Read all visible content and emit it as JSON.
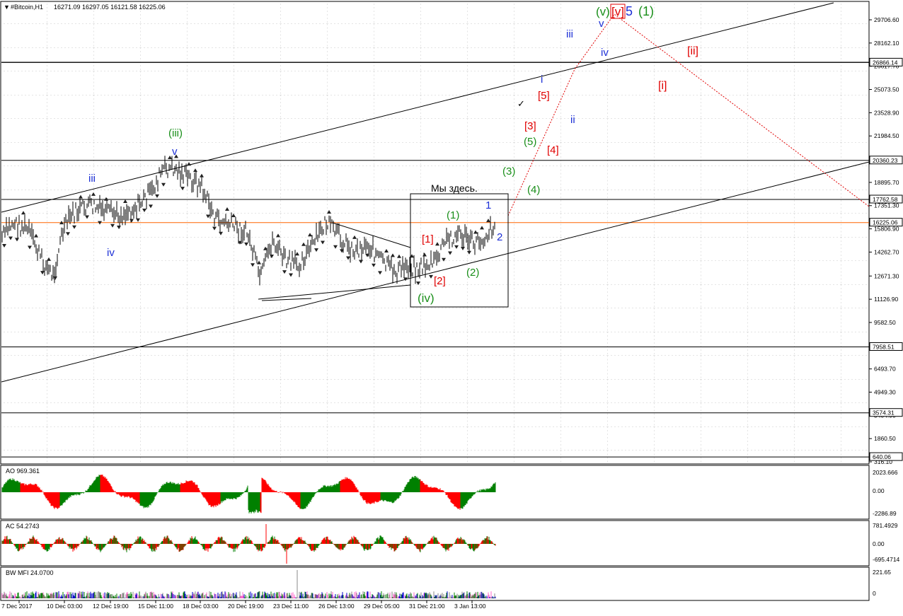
{
  "chart_data": {
    "type": "candlestick",
    "symbol": "#Bitcoin,H1",
    "ohlc": "16271.09 16297.05 16121.58 16225.06",
    "current_price": 16225.06,
    "ylim": [
      316.1,
      31500
    ],
    "price_ticks": [
      "29706.60",
      "28162.10",
      "26617.70",
      "25073.50",
      "23528.90",
      "21984.50",
      "20440.10",
      "18895.70",
      "17351.30",
      "15806.90",
      "14262.70",
      "12671.30",
      "11126.90",
      "9582.50",
      "8038.10",
      "6493.70",
      "4949.30",
      "3404.90",
      "1860.50",
      "316.10"
    ],
    "horizontal_levels": [
      {
        "value": 26866.14,
        "label": "26866.14",
        "color": "#000000"
      },
      {
        "value": 20360.23,
        "label": "20360.23",
        "color": "#000000"
      },
      {
        "value": 17762.58,
        "label": "17762.58",
        "color": "#000000"
      },
      {
        "value": 16225.06,
        "label": "16225.06",
        "color": "#ff6600"
      },
      {
        "value": 7958.51,
        "label": "7958.51",
        "color": "#000000"
      },
      {
        "value": 3574.31,
        "label": "3574.31",
        "color": "#000000"
      },
      {
        "value": 640.06,
        "label": "640.06",
        "color": "#000000"
      }
    ],
    "time_labels": [
      "7 Dec 2017",
      "10 Dec 03:00",
      "12 Dec 19:00",
      "15 Dec 11:00",
      "18 Dec 03:00",
      "20 Dec 19:00",
      "23 Dec 11:00",
      "26 Dec 13:00",
      "29 Dec 05:00",
      "31 Dec 21:00",
      "3 Jan 13:00"
    ],
    "annotation_box_label": "Мы здесь.",
    "wave_labels": [
      {
        "text": "(iii)",
        "color": "green"
      },
      {
        "text": "v",
        "color": "blue"
      },
      {
        "text": "iii",
        "color": "blue"
      },
      {
        "text": "iv",
        "color": "blue"
      },
      {
        "text": "(iv)",
        "color": "green"
      },
      {
        "text": "[1]",
        "color": "red"
      },
      {
        "text": "[2]",
        "color": "red"
      },
      {
        "text": "(1)",
        "color": "green"
      },
      {
        "text": "(2)",
        "color": "green"
      },
      {
        "text": "1",
        "color": "blue"
      },
      {
        "text": "2",
        "color": "blue"
      },
      {
        "text": "(3)",
        "color": "green"
      },
      {
        "text": "(4)",
        "color": "green"
      },
      {
        "text": "(5)",
        "color": "green"
      },
      {
        "text": "[3]",
        "color": "red"
      },
      {
        "text": "[4]",
        "color": "red"
      },
      {
        "text": "[5]",
        "color": "red"
      },
      {
        "text": "i",
        "color": "blue"
      },
      {
        "text": "ii",
        "color": "blue"
      },
      {
        "text": "iii",
        "color": "blue"
      },
      {
        "text": "iv",
        "color": "blue"
      },
      {
        "text": "v",
        "color": "blue"
      },
      {
        "text": "(v)",
        "color": "green"
      },
      {
        "text": "[v]",
        "color": "red"
      },
      {
        "text": "5",
        "color": "blue"
      },
      {
        "text": "(1)",
        "color": "green"
      },
      {
        "text": "[ii]",
        "color": "red"
      },
      {
        "text": "[i]",
        "color": "red"
      }
    ],
    "indicators": [
      {
        "name": "AO 969.361",
        "ticks": [
          "2023.666",
          "0.00",
          "-2286.89"
        ]
      },
      {
        "name": "AC 54.2743",
        "ticks": [
          "781.4929",
          "0.00",
          "-695.4714"
        ]
      },
      {
        "name": "BW MFI 24.0700",
        "ticks": [
          "221.65",
          "0"
        ]
      }
    ]
  },
  "colors": {
    "up": "#008000",
    "down": "#ff0000",
    "wave_green": "#1a8f1a",
    "wave_blue": "#1c2fd6",
    "wave_red": "#e00000",
    "current_price_line": "#ff6600"
  }
}
